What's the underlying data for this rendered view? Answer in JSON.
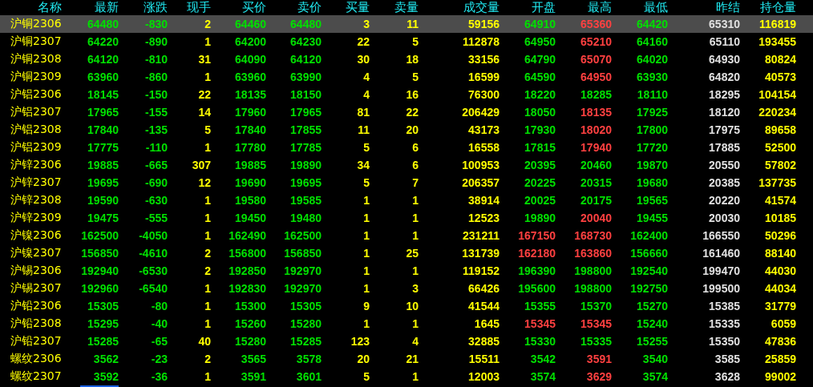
{
  "columns": [
    {
      "label": "名称",
      "selected": false
    },
    {
      "label": "最新",
      "selected": true
    },
    {
      "label": "涨跌",
      "selected": false
    },
    {
      "label": "现手",
      "selected": false
    },
    {
      "label": "买价",
      "selected": false
    },
    {
      "label": "卖价",
      "selected": false
    },
    {
      "label": "买量",
      "selected": false
    },
    {
      "label": "卖量",
      "selected": false
    },
    {
      "label": "成交量",
      "selected": false
    },
    {
      "label": "开盘",
      "selected": false
    },
    {
      "label": "最高",
      "selected": false
    },
    {
      "label": "最低",
      "selected": false
    },
    {
      "label": "昨结",
      "selected": false
    },
    {
      "label": "持仓量",
      "selected": false
    }
  ],
  "rows": [
    {
      "selected": true,
      "cells": [
        {
          "text": "沪铜2306",
          "color": "#ffff00"
        },
        {
          "text": "64480",
          "color": "#00e000"
        },
        {
          "text": "-830",
          "color": "#00e000"
        },
        {
          "text": "2",
          "color": "#ffff00"
        },
        {
          "text": "64460",
          "color": "#00e000"
        },
        {
          "text": "64480",
          "color": "#00e000"
        },
        {
          "text": "3",
          "color": "#ffff00"
        },
        {
          "text": "11",
          "color": "#ffff00"
        },
        {
          "text": "59156",
          "color": "#ffff00"
        },
        {
          "text": "64910",
          "color": "#00e000"
        },
        {
          "text": "65360",
          "color": "#ff4040"
        },
        {
          "text": "64420",
          "color": "#00e000"
        },
        {
          "text": "65310",
          "color": "#e0e0e0"
        },
        {
          "text": "116819",
          "color": "#ffff00"
        }
      ]
    },
    {
      "selected": false,
      "cells": [
        {
          "text": "沪铜2307",
          "color": "#ffff00"
        },
        {
          "text": "64220",
          "color": "#00e000"
        },
        {
          "text": "-890",
          "color": "#00e000"
        },
        {
          "text": "1",
          "color": "#ffff00"
        },
        {
          "text": "64200",
          "color": "#00e000"
        },
        {
          "text": "64230",
          "color": "#00e000"
        },
        {
          "text": "22",
          "color": "#ffff00"
        },
        {
          "text": "5",
          "color": "#ffff00"
        },
        {
          "text": "112878",
          "color": "#ffff00"
        },
        {
          "text": "64950",
          "color": "#00e000"
        },
        {
          "text": "65210",
          "color": "#ff4040"
        },
        {
          "text": "64160",
          "color": "#00e000"
        },
        {
          "text": "65110",
          "color": "#e0e0e0"
        },
        {
          "text": "193455",
          "color": "#ffff00"
        }
      ]
    },
    {
      "selected": false,
      "cells": [
        {
          "text": "沪铜2308",
          "color": "#ffff00"
        },
        {
          "text": "64120",
          "color": "#00e000"
        },
        {
          "text": "-810",
          "color": "#00e000"
        },
        {
          "text": "31",
          "color": "#ffff00"
        },
        {
          "text": "64090",
          "color": "#00e000"
        },
        {
          "text": "64120",
          "color": "#00e000"
        },
        {
          "text": "30",
          "color": "#ffff00"
        },
        {
          "text": "18",
          "color": "#ffff00"
        },
        {
          "text": "33156",
          "color": "#ffff00"
        },
        {
          "text": "64790",
          "color": "#00e000"
        },
        {
          "text": "65070",
          "color": "#ff4040"
        },
        {
          "text": "64020",
          "color": "#00e000"
        },
        {
          "text": "64930",
          "color": "#e0e0e0"
        },
        {
          "text": "80824",
          "color": "#ffff00"
        }
      ]
    },
    {
      "selected": false,
      "cells": [
        {
          "text": "沪铜2309",
          "color": "#ffff00"
        },
        {
          "text": "63960",
          "color": "#00e000"
        },
        {
          "text": "-860",
          "color": "#00e000"
        },
        {
          "text": "1",
          "color": "#ffff00"
        },
        {
          "text": "63960",
          "color": "#00e000"
        },
        {
          "text": "63990",
          "color": "#00e000"
        },
        {
          "text": "4",
          "color": "#ffff00"
        },
        {
          "text": "5",
          "color": "#ffff00"
        },
        {
          "text": "16599",
          "color": "#ffff00"
        },
        {
          "text": "64590",
          "color": "#00e000"
        },
        {
          "text": "64950",
          "color": "#ff4040"
        },
        {
          "text": "63930",
          "color": "#00e000"
        },
        {
          "text": "64820",
          "color": "#e0e0e0"
        },
        {
          "text": "40573",
          "color": "#ffff00"
        }
      ]
    },
    {
      "selected": false,
      "cells": [
        {
          "text": "沪铝2306",
          "color": "#ffff00"
        },
        {
          "text": "18145",
          "color": "#00e000"
        },
        {
          "text": "-150",
          "color": "#00e000"
        },
        {
          "text": "22",
          "color": "#ffff00"
        },
        {
          "text": "18135",
          "color": "#00e000"
        },
        {
          "text": "18150",
          "color": "#00e000"
        },
        {
          "text": "4",
          "color": "#ffff00"
        },
        {
          "text": "16",
          "color": "#ffff00"
        },
        {
          "text": "76300",
          "color": "#ffff00"
        },
        {
          "text": "18220",
          "color": "#00e000"
        },
        {
          "text": "18285",
          "color": "#00e000"
        },
        {
          "text": "18110",
          "color": "#00e000"
        },
        {
          "text": "18295",
          "color": "#e0e0e0"
        },
        {
          "text": "104154",
          "color": "#ffff00"
        }
      ]
    },
    {
      "selected": false,
      "cells": [
        {
          "text": "沪铝2307",
          "color": "#ffff00"
        },
        {
          "text": "17965",
          "color": "#00e000"
        },
        {
          "text": "-155",
          "color": "#00e000"
        },
        {
          "text": "14",
          "color": "#ffff00"
        },
        {
          "text": "17960",
          "color": "#00e000"
        },
        {
          "text": "17965",
          "color": "#00e000"
        },
        {
          "text": "81",
          "color": "#ffff00"
        },
        {
          "text": "22",
          "color": "#ffff00"
        },
        {
          "text": "206429",
          "color": "#ffff00"
        },
        {
          "text": "18050",
          "color": "#00e000"
        },
        {
          "text": "18135",
          "color": "#ff4040"
        },
        {
          "text": "17925",
          "color": "#00e000"
        },
        {
          "text": "18120",
          "color": "#e0e0e0"
        },
        {
          "text": "220234",
          "color": "#ffff00"
        }
      ]
    },
    {
      "selected": false,
      "cells": [
        {
          "text": "沪铝2308",
          "color": "#ffff00"
        },
        {
          "text": "17840",
          "color": "#00e000"
        },
        {
          "text": "-135",
          "color": "#00e000"
        },
        {
          "text": "5",
          "color": "#ffff00"
        },
        {
          "text": "17840",
          "color": "#00e000"
        },
        {
          "text": "17855",
          "color": "#00e000"
        },
        {
          "text": "11",
          "color": "#ffff00"
        },
        {
          "text": "20",
          "color": "#ffff00"
        },
        {
          "text": "43173",
          "color": "#ffff00"
        },
        {
          "text": "17930",
          "color": "#00e000"
        },
        {
          "text": "18020",
          "color": "#ff4040"
        },
        {
          "text": "17800",
          "color": "#00e000"
        },
        {
          "text": "17975",
          "color": "#e0e0e0"
        },
        {
          "text": "89658",
          "color": "#ffff00"
        }
      ]
    },
    {
      "selected": false,
      "cells": [
        {
          "text": "沪铝2309",
          "color": "#ffff00"
        },
        {
          "text": "17775",
          "color": "#00e000"
        },
        {
          "text": "-110",
          "color": "#00e000"
        },
        {
          "text": "1",
          "color": "#ffff00"
        },
        {
          "text": "17780",
          "color": "#00e000"
        },
        {
          "text": "17785",
          "color": "#00e000"
        },
        {
          "text": "5",
          "color": "#ffff00"
        },
        {
          "text": "6",
          "color": "#ffff00"
        },
        {
          "text": "16558",
          "color": "#ffff00"
        },
        {
          "text": "17815",
          "color": "#00e000"
        },
        {
          "text": "17940",
          "color": "#ff4040"
        },
        {
          "text": "17720",
          "color": "#00e000"
        },
        {
          "text": "17885",
          "color": "#e0e0e0"
        },
        {
          "text": "52500",
          "color": "#ffff00"
        }
      ]
    },
    {
      "selected": false,
      "cells": [
        {
          "text": "沪锌2306",
          "color": "#ffff00"
        },
        {
          "text": "19885",
          "color": "#00e000"
        },
        {
          "text": "-665",
          "color": "#00e000"
        },
        {
          "text": "307",
          "color": "#ffff00"
        },
        {
          "text": "19885",
          "color": "#00e000"
        },
        {
          "text": "19890",
          "color": "#00e000"
        },
        {
          "text": "34",
          "color": "#ffff00"
        },
        {
          "text": "6",
          "color": "#ffff00"
        },
        {
          "text": "100953",
          "color": "#ffff00"
        },
        {
          "text": "20395",
          "color": "#00e000"
        },
        {
          "text": "20460",
          "color": "#00e000"
        },
        {
          "text": "19870",
          "color": "#00e000"
        },
        {
          "text": "20550",
          "color": "#e0e0e0"
        },
        {
          "text": "57802",
          "color": "#ffff00"
        }
      ]
    },
    {
      "selected": false,
      "cells": [
        {
          "text": "沪锌2307",
          "color": "#ffff00"
        },
        {
          "text": "19695",
          "color": "#00e000"
        },
        {
          "text": "-690",
          "color": "#00e000"
        },
        {
          "text": "12",
          "color": "#ffff00"
        },
        {
          "text": "19690",
          "color": "#00e000"
        },
        {
          "text": "19695",
          "color": "#00e000"
        },
        {
          "text": "5",
          "color": "#ffff00"
        },
        {
          "text": "7",
          "color": "#ffff00"
        },
        {
          "text": "206357",
          "color": "#ffff00"
        },
        {
          "text": "20225",
          "color": "#00e000"
        },
        {
          "text": "20315",
          "color": "#00e000"
        },
        {
          "text": "19680",
          "color": "#00e000"
        },
        {
          "text": "20385",
          "color": "#e0e0e0"
        },
        {
          "text": "137735",
          "color": "#ffff00"
        }
      ]
    },
    {
      "selected": false,
      "cells": [
        {
          "text": "沪锌2308",
          "color": "#ffff00"
        },
        {
          "text": "19590",
          "color": "#00e000"
        },
        {
          "text": "-630",
          "color": "#00e000"
        },
        {
          "text": "1",
          "color": "#ffff00"
        },
        {
          "text": "19580",
          "color": "#00e000"
        },
        {
          "text": "19585",
          "color": "#00e000"
        },
        {
          "text": "1",
          "color": "#ffff00"
        },
        {
          "text": "1",
          "color": "#ffff00"
        },
        {
          "text": "38914",
          "color": "#ffff00"
        },
        {
          "text": "20025",
          "color": "#00e000"
        },
        {
          "text": "20175",
          "color": "#00e000"
        },
        {
          "text": "19565",
          "color": "#00e000"
        },
        {
          "text": "20220",
          "color": "#e0e0e0"
        },
        {
          "text": "41574",
          "color": "#ffff00"
        }
      ]
    },
    {
      "selected": false,
      "cells": [
        {
          "text": "沪锌2309",
          "color": "#ffff00"
        },
        {
          "text": "19475",
          "color": "#00e000"
        },
        {
          "text": "-555",
          "color": "#00e000"
        },
        {
          "text": "1",
          "color": "#ffff00"
        },
        {
          "text": "19450",
          "color": "#00e000"
        },
        {
          "text": "19480",
          "color": "#00e000"
        },
        {
          "text": "1",
          "color": "#ffff00"
        },
        {
          "text": "1",
          "color": "#ffff00"
        },
        {
          "text": "12523",
          "color": "#ffff00"
        },
        {
          "text": "19890",
          "color": "#00e000"
        },
        {
          "text": "20040",
          "color": "#ff4040"
        },
        {
          "text": "19455",
          "color": "#00e000"
        },
        {
          "text": "20030",
          "color": "#e0e0e0"
        },
        {
          "text": "10185",
          "color": "#ffff00"
        }
      ]
    },
    {
      "selected": false,
      "cells": [
        {
          "text": "沪镍2306",
          "color": "#ffff00"
        },
        {
          "text": "162500",
          "color": "#00e000"
        },
        {
          "text": "-4050",
          "color": "#00e000"
        },
        {
          "text": "1",
          "color": "#ffff00"
        },
        {
          "text": "162490",
          "color": "#00e000"
        },
        {
          "text": "162500",
          "color": "#00e000"
        },
        {
          "text": "1",
          "color": "#ffff00"
        },
        {
          "text": "1",
          "color": "#ffff00"
        },
        {
          "text": "231211",
          "color": "#ffff00"
        },
        {
          "text": "167150",
          "color": "#ff4040"
        },
        {
          "text": "168730",
          "color": "#ff4040"
        },
        {
          "text": "162400",
          "color": "#00e000"
        },
        {
          "text": "166550",
          "color": "#e0e0e0"
        },
        {
          "text": "50296",
          "color": "#ffff00"
        }
      ]
    },
    {
      "selected": false,
      "cells": [
        {
          "text": "沪镍2307",
          "color": "#ffff00"
        },
        {
          "text": "156850",
          "color": "#00e000"
        },
        {
          "text": "-4610",
          "color": "#00e000"
        },
        {
          "text": "2",
          "color": "#ffff00"
        },
        {
          "text": "156800",
          "color": "#00e000"
        },
        {
          "text": "156850",
          "color": "#00e000"
        },
        {
          "text": "1",
          "color": "#ffff00"
        },
        {
          "text": "25",
          "color": "#ffff00"
        },
        {
          "text": "131739",
          "color": "#ffff00"
        },
        {
          "text": "162180",
          "color": "#ff4040"
        },
        {
          "text": "163860",
          "color": "#ff4040"
        },
        {
          "text": "156660",
          "color": "#00e000"
        },
        {
          "text": "161460",
          "color": "#e0e0e0"
        },
        {
          "text": "88140",
          "color": "#ffff00"
        }
      ]
    },
    {
      "selected": false,
      "cells": [
        {
          "text": "沪锡2306",
          "color": "#ffff00"
        },
        {
          "text": "192940",
          "color": "#00e000"
        },
        {
          "text": "-6530",
          "color": "#00e000"
        },
        {
          "text": "2",
          "color": "#ffff00"
        },
        {
          "text": "192850",
          "color": "#00e000"
        },
        {
          "text": "192970",
          "color": "#00e000"
        },
        {
          "text": "1",
          "color": "#ffff00"
        },
        {
          "text": "1",
          "color": "#ffff00"
        },
        {
          "text": "119152",
          "color": "#ffff00"
        },
        {
          "text": "196390",
          "color": "#00e000"
        },
        {
          "text": "198800",
          "color": "#00e000"
        },
        {
          "text": "192540",
          "color": "#00e000"
        },
        {
          "text": "199470",
          "color": "#e0e0e0"
        },
        {
          "text": "44030",
          "color": "#ffff00"
        }
      ]
    },
    {
      "selected": false,
      "cells": [
        {
          "text": "沪锡2307",
          "color": "#ffff00"
        },
        {
          "text": "192960",
          "color": "#00e000"
        },
        {
          "text": "-6540",
          "color": "#00e000"
        },
        {
          "text": "1",
          "color": "#ffff00"
        },
        {
          "text": "192830",
          "color": "#00e000"
        },
        {
          "text": "192970",
          "color": "#00e000"
        },
        {
          "text": "1",
          "color": "#ffff00"
        },
        {
          "text": "3",
          "color": "#ffff00"
        },
        {
          "text": "66426",
          "color": "#ffff00"
        },
        {
          "text": "195600",
          "color": "#00e000"
        },
        {
          "text": "198800",
          "color": "#00e000"
        },
        {
          "text": "192750",
          "color": "#00e000"
        },
        {
          "text": "199500",
          "color": "#e0e0e0"
        },
        {
          "text": "44034",
          "color": "#ffff00"
        }
      ]
    },
    {
      "selected": false,
      "cells": [
        {
          "text": "沪铅2306",
          "color": "#ffff00"
        },
        {
          "text": "15305",
          "color": "#00e000"
        },
        {
          "text": "-80",
          "color": "#00e000"
        },
        {
          "text": "1",
          "color": "#ffff00"
        },
        {
          "text": "15300",
          "color": "#00e000"
        },
        {
          "text": "15305",
          "color": "#00e000"
        },
        {
          "text": "9",
          "color": "#ffff00"
        },
        {
          "text": "10",
          "color": "#ffff00"
        },
        {
          "text": "41544",
          "color": "#ffff00"
        },
        {
          "text": "15355",
          "color": "#00e000"
        },
        {
          "text": "15370",
          "color": "#00e000"
        },
        {
          "text": "15270",
          "color": "#00e000"
        },
        {
          "text": "15385",
          "color": "#e0e0e0"
        },
        {
          "text": "31779",
          "color": "#ffff00"
        }
      ]
    },
    {
      "selected": false,
      "cells": [
        {
          "text": "沪铅2308",
          "color": "#ffff00"
        },
        {
          "text": "15295",
          "color": "#00e000"
        },
        {
          "text": "-40",
          "color": "#00e000"
        },
        {
          "text": "1",
          "color": "#ffff00"
        },
        {
          "text": "15260",
          "color": "#00e000"
        },
        {
          "text": "15280",
          "color": "#00e000"
        },
        {
          "text": "1",
          "color": "#ffff00"
        },
        {
          "text": "1",
          "color": "#ffff00"
        },
        {
          "text": "1645",
          "color": "#ffff00"
        },
        {
          "text": "15345",
          "color": "#ff4040"
        },
        {
          "text": "15345",
          "color": "#ff4040"
        },
        {
          "text": "15240",
          "color": "#00e000"
        },
        {
          "text": "15335",
          "color": "#e0e0e0"
        },
        {
          "text": "6059",
          "color": "#ffff00"
        }
      ]
    },
    {
      "selected": false,
      "cells": [
        {
          "text": "沪铅2307",
          "color": "#ffff00"
        },
        {
          "text": "15285",
          "color": "#00e000"
        },
        {
          "text": "-65",
          "color": "#00e000"
        },
        {
          "text": "40",
          "color": "#ffff00"
        },
        {
          "text": "15280",
          "color": "#00e000"
        },
        {
          "text": "15285",
          "color": "#00e000"
        },
        {
          "text": "123",
          "color": "#ffff00"
        },
        {
          "text": "4",
          "color": "#ffff00"
        },
        {
          "text": "32885",
          "color": "#ffff00"
        },
        {
          "text": "15330",
          "color": "#00e000"
        },
        {
          "text": "15335",
          "color": "#00e000"
        },
        {
          "text": "15255",
          "color": "#00e000"
        },
        {
          "text": "15350",
          "color": "#e0e0e0"
        },
        {
          "text": "47836",
          "color": "#ffff00"
        }
      ]
    },
    {
      "selected": false,
      "cells": [
        {
          "text": "螺纹2306",
          "color": "#ffff00"
        },
        {
          "text": "3562",
          "color": "#00e000"
        },
        {
          "text": "-23",
          "color": "#00e000"
        },
        {
          "text": "2",
          "color": "#ffff00"
        },
        {
          "text": "3565",
          "color": "#00e000"
        },
        {
          "text": "3578",
          "color": "#00e000"
        },
        {
          "text": "20",
          "color": "#ffff00"
        },
        {
          "text": "21",
          "color": "#ffff00"
        },
        {
          "text": "15511",
          "color": "#ffff00"
        },
        {
          "text": "3542",
          "color": "#00e000"
        },
        {
          "text": "3591",
          "color": "#ff4040"
        },
        {
          "text": "3540",
          "color": "#00e000"
        },
        {
          "text": "3585",
          "color": "#e0e0e0"
        },
        {
          "text": "25859",
          "color": "#ffff00"
        }
      ]
    },
    {
      "selected": false,
      "cells": [
        {
          "text": "螺纹2307",
          "color": "#ffff00"
        },
        {
          "text": "3592",
          "color": "#00e000"
        },
        {
          "text": "-36",
          "color": "#00e000"
        },
        {
          "text": "1",
          "color": "#ffff00"
        },
        {
          "text": "3591",
          "color": "#00e000"
        },
        {
          "text": "3601",
          "color": "#00e000"
        },
        {
          "text": "5",
          "color": "#ffff00"
        },
        {
          "text": "1",
          "color": "#ffff00"
        },
        {
          "text": "12003",
          "color": "#ffff00"
        },
        {
          "text": "3574",
          "color": "#00e000"
        },
        {
          "text": "3629",
          "color": "#ff4040"
        },
        {
          "text": "3574",
          "color": "#00e000"
        },
        {
          "text": "3628",
          "color": "#e0e0e0"
        },
        {
          "text": "99002",
          "color": "#ffff00"
        }
      ]
    }
  ]
}
